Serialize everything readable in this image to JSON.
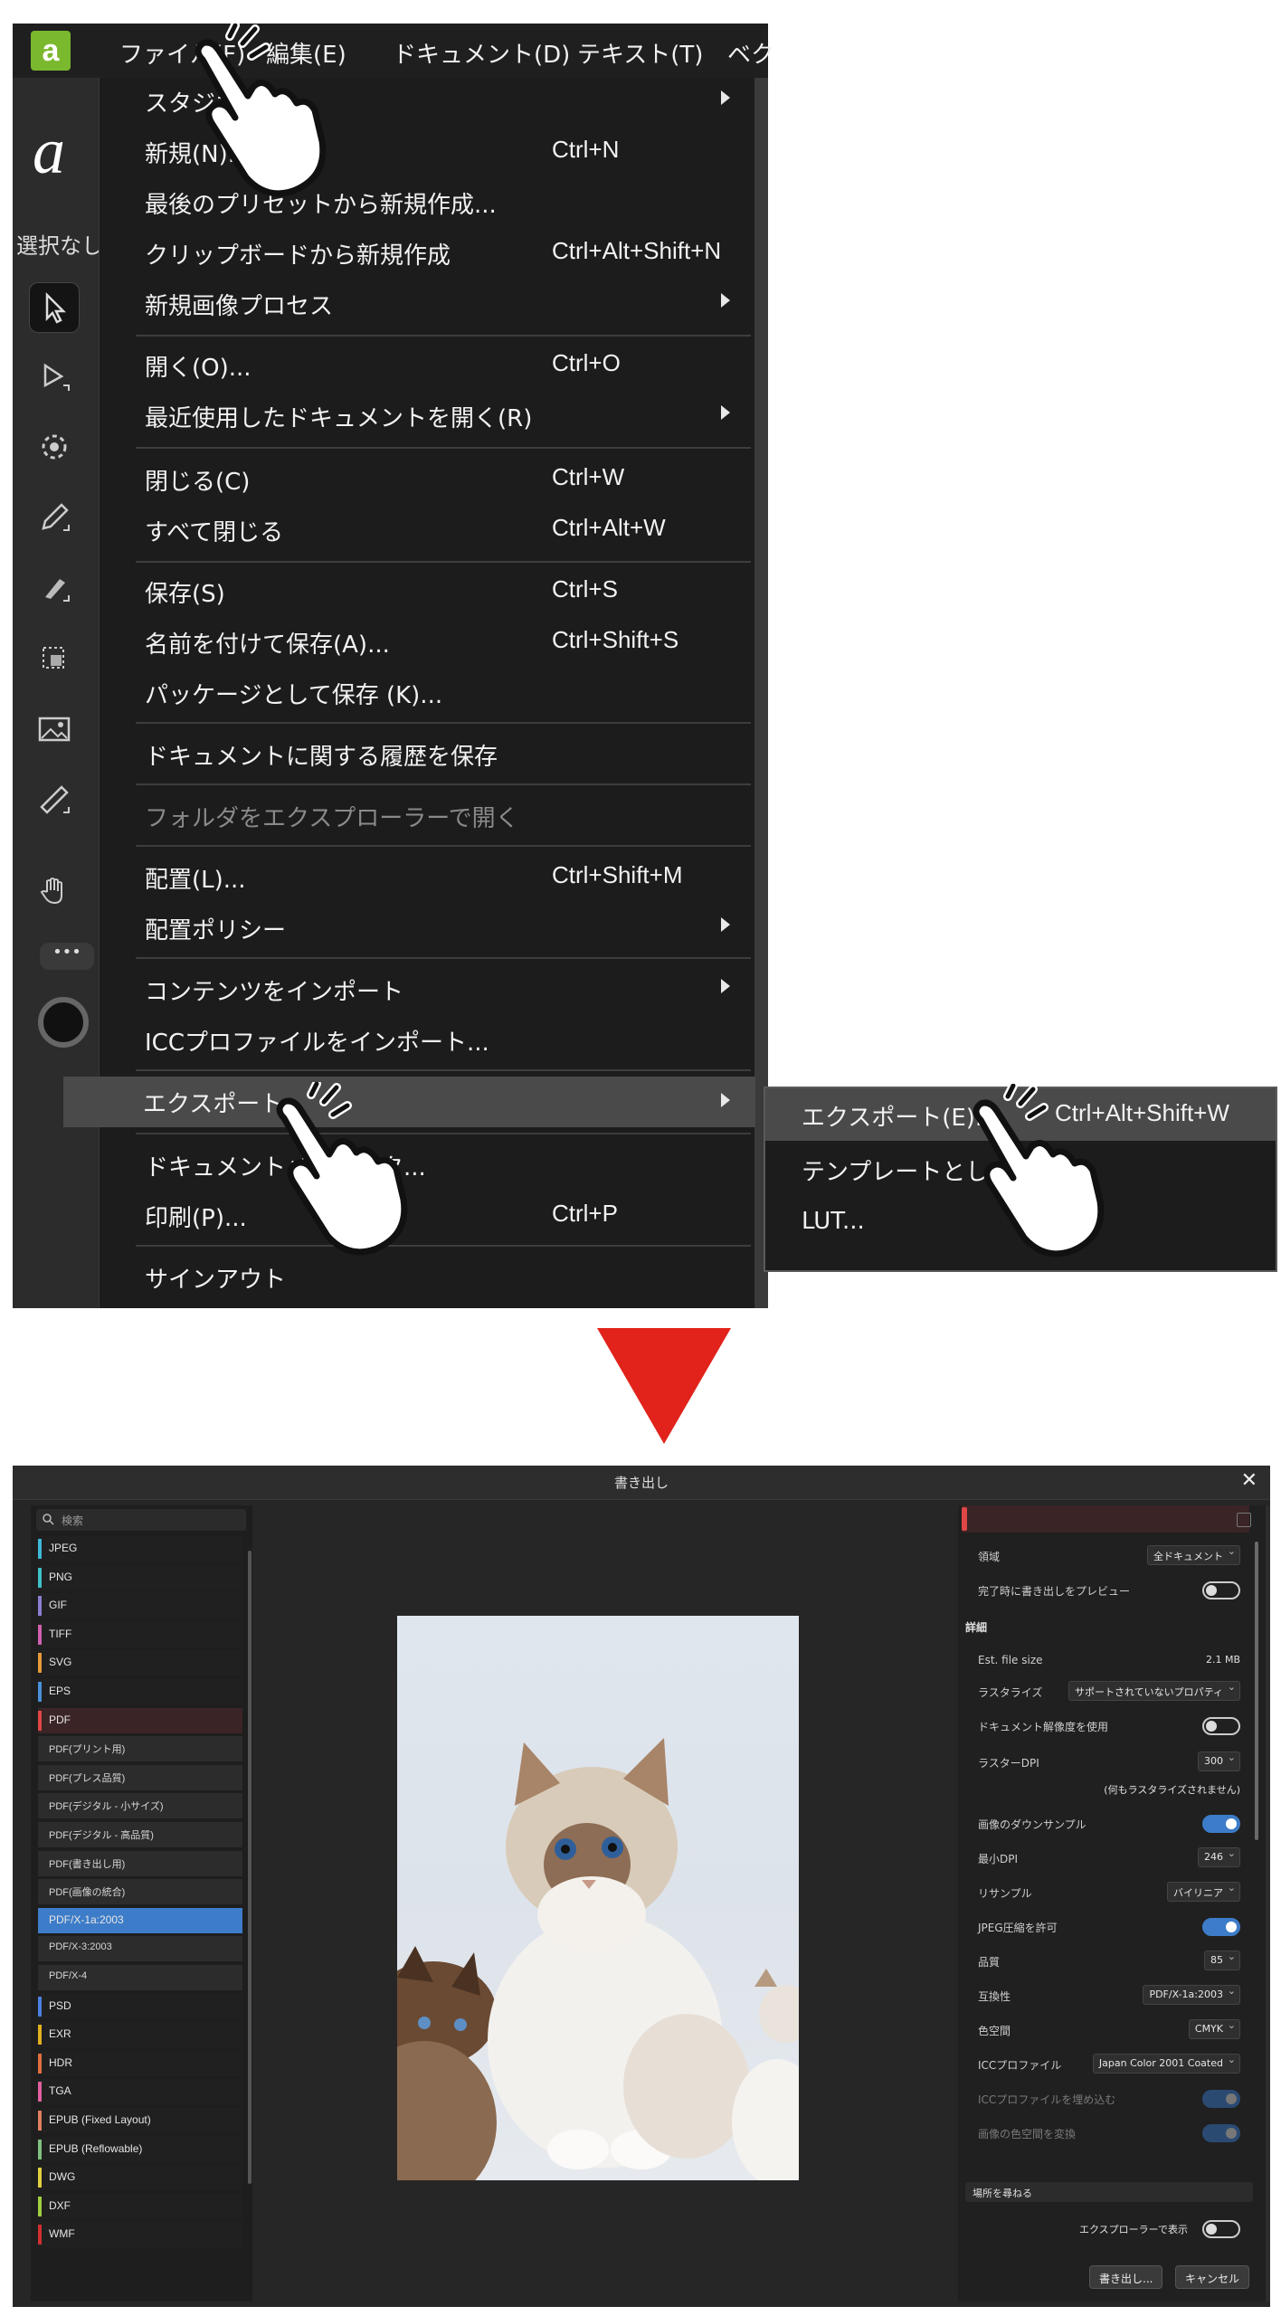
{
  "menubar": {
    "app_logo": "a",
    "items": [
      "ファイル(F)",
      "編集(E)",
      "ドキュメント(D)",
      "テキスト(T)",
      "ベク"
    ]
  },
  "toolbar": {
    "logo": "a",
    "selection_label": "選択なし",
    "tools": [
      "move-tool-icon",
      "node-tool-icon",
      "rotate-tool-icon",
      "pencil-tool-icon",
      "brush-tool-icon",
      "crop-tool-icon",
      "image-tool-icon",
      "measure-tool-icon",
      "hand-tool-icon"
    ],
    "more": "•••"
  },
  "file_menu": {
    "items": [
      {
        "label": "スタジオ",
        "shortcut": "",
        "submenu": true
      },
      {
        "label": "新規(N)...",
        "shortcut": "Ctrl+N",
        "submenu": false
      },
      {
        "label": "最後のプリセットから新規作成...",
        "shortcut": "",
        "submenu": false
      },
      {
        "label": "クリップボードから新規作成",
        "shortcut": "Ctrl+Alt+Shift+N",
        "submenu": false
      },
      {
        "label": "新規画像プロセス",
        "shortcut": "",
        "submenu": true
      },
      {
        "label": "開く(O)...",
        "shortcut": "Ctrl+O",
        "submenu": false
      },
      {
        "label": "最近使用したドキュメントを開く(R)",
        "shortcut": "",
        "submenu": true
      },
      {
        "label": "閉じる(C)",
        "shortcut": "Ctrl+W",
        "submenu": false
      },
      {
        "label": "すべて閉じる",
        "shortcut": "Ctrl+Alt+W",
        "submenu": false
      },
      {
        "label": "保存(S)",
        "shortcut": "Ctrl+S",
        "submenu": false
      },
      {
        "label": "名前を付けて保存(A)...",
        "shortcut": "Ctrl+Shift+S",
        "submenu": false
      },
      {
        "label": "パッケージとして保存 (K)...",
        "shortcut": "",
        "submenu": false
      },
      {
        "label": "ドキュメントに関する履歴を保存",
        "shortcut": "",
        "submenu": false
      },
      {
        "label": "フォルダをエクスプローラーで開く",
        "shortcut": "",
        "submenu": false,
        "disabled": true
      },
      {
        "label": "配置(L)...",
        "shortcut": "Ctrl+Shift+M",
        "submenu": false
      },
      {
        "label": "配置ポリシー",
        "shortcut": "",
        "submenu": true
      },
      {
        "label": "コンテンツをインポート",
        "shortcut": "",
        "submenu": true
      },
      {
        "label": "ICCプロファイルをインポート...",
        "shortcut": "",
        "submenu": false
      },
      {
        "label": "エクスポート",
        "shortcut": "",
        "submenu": true,
        "highlighted": true
      },
      {
        "label": "ドキュメントメタデータ...",
        "shortcut": "",
        "submenu": false
      },
      {
        "label": "印刷(P)...",
        "shortcut": "Ctrl+P",
        "submenu": false
      },
      {
        "label": "サインアウト",
        "shortcut": "",
        "submenu": false
      }
    ]
  },
  "export_submenu": {
    "items": [
      {
        "label": "エクスポート(E)...",
        "shortcut": "Ctrl+Alt+Shift+W",
        "highlighted": true
      },
      {
        "label": "テンプレートとして...",
        "shortcut": ""
      },
      {
        "label": "LUT...",
        "shortcut": ""
      }
    ]
  },
  "arrow_color": "#e1231b",
  "dialog": {
    "title": "書き出し",
    "close": "✕",
    "search_placeholder": "検索",
    "formats": [
      {
        "name": "JPEG",
        "color": "#3fb8d8"
      },
      {
        "name": "PNG",
        "color": "#3fc0c8"
      },
      {
        "name": "GIF",
        "color": "#8a7fd0"
      },
      {
        "name": "TIFF",
        "color": "#d060b0"
      },
      {
        "name": "SVG",
        "color": "#e89a3a"
      },
      {
        "name": "EPS",
        "color": "#4a90d8"
      },
      {
        "name": "PDF",
        "color": "#e04646",
        "kind": "pdf"
      },
      {
        "name": "PDF(プリント用)",
        "kind": "sub"
      },
      {
        "name": "PDF(プレス品質)",
        "kind": "sub"
      },
      {
        "name": "PDF(デジタル - 小サイズ)",
        "kind": "sub"
      },
      {
        "name": "PDF(デジタル - 高品質)",
        "kind": "sub"
      },
      {
        "name": "PDF(書き出し用)",
        "kind": "sub"
      },
      {
        "name": "PDF(画像の統合)",
        "kind": "sub"
      },
      {
        "name": "PDF/X-1a:2003",
        "kind": "sel"
      },
      {
        "name": "PDF/X-3:2003",
        "kind": "sub"
      },
      {
        "name": "PDF/X-4",
        "kind": "sub"
      },
      {
        "name": "PSD",
        "color": "#4a80e0"
      },
      {
        "name": "EXR",
        "color": "#e0b020"
      },
      {
        "name": "HDR",
        "color": "#e07040"
      },
      {
        "name": "TGA",
        "color": "#e060a0"
      },
      {
        "name": "EPUB (Fixed Layout)",
        "color": "#e08060"
      },
      {
        "name": "EPUB (Reflowable)",
        "color": "#80c080"
      },
      {
        "name": "DWG",
        "color": "#e0d040"
      },
      {
        "name": "DXF",
        "color": "#a0d040"
      },
      {
        "name": "WMF",
        "color": "#d03030"
      }
    ],
    "settings": {
      "area_label": "領域",
      "area_value": "全ドキュメント",
      "preview_label": "完了時に書き出しをプレビュー",
      "details_heading": "詳細",
      "filesize_label": "Est. file size",
      "filesize_value": "2.1 MB",
      "rasterize_label": "ラスタライズ",
      "rasterize_value": "サポートされていないプロパティ",
      "docres_label": "ドキュメント解像度を使用",
      "dpi_label": "ラスターDPI",
      "dpi_value": "300",
      "nothing_rasterized": "(何もラスタライズされません)",
      "downsample_label": "画像のダウンサンプル",
      "min_dpi_label": "最小DPI",
      "min_dpi_value": "246",
      "resample_label": "リサンプル",
      "resample_value": "バイリニア",
      "jpeg_label": "JPEG圧縮を許可",
      "quality_label": "品質",
      "quality_value": "85",
      "compat_label": "互換性",
      "compat_value": "PDF/X-1a:2003",
      "colorspace_label": "色空間",
      "colorspace_value": "CMYK",
      "icc_label": "ICCプロファイル",
      "icc_value": "Japan Color 2001 Coated",
      "embed_icc_label": "ICCプロファイルを埋め込む",
      "convert_label": "画像の色空間を変換",
      "location_label": "場所を尋ねる",
      "explorer_label": "エクスプローラーで表示",
      "export_button": "書き出し...",
      "cancel_button": "キャンセル"
    }
  }
}
